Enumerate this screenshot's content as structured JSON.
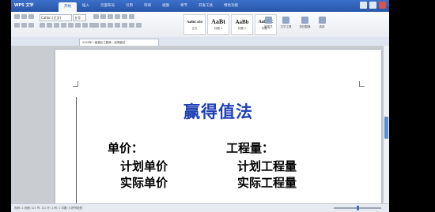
{
  "app": {
    "title": "WPS 文字"
  },
  "menu": {
    "tabs": [
      "开始",
      "插入",
      "页面布局",
      "引用",
      "审阅",
      "视图",
      "章节",
      "开发工具",
      "特色功能"
    ],
    "active_index": 0
  },
  "ribbon": {
    "font_value": "Calibri (正文)",
    "size_value": "五号",
    "styles": [
      {
        "sample": "AaBbCcDd",
        "label": "正文"
      },
      {
        "sample": "AaBt",
        "label": "标题 1"
      },
      {
        "sample": "AaBb",
        "label": "标题 2"
      },
      {
        "sample": "AaBbC",
        "label": "标题 3"
      }
    ],
    "tools": [
      {
        "icon": "new-style-icon",
        "label": "新样式"
      },
      {
        "icon": "text-tools-icon",
        "label": "文字工具"
      },
      {
        "icon": "find-replace-icon",
        "label": "查找替换"
      },
      {
        "icon": "select-icon",
        "label": "选择"
      }
    ]
  },
  "document_tab": {
    "label": "2020年一级造价工程师 - 赢得值法"
  },
  "document": {
    "title": "赢得值法",
    "left_heading": "单价：",
    "left_items": [
      "计划单价",
      "实际单价"
    ],
    "right_heading": "工程量：",
    "right_items": [
      "计划工程量",
      "实际工程量"
    ]
  },
  "status": {
    "text": "页码: 1  页面: 1/1  节: 1/1  行: 1  列: 1  字数: 0  拼写检查"
  }
}
